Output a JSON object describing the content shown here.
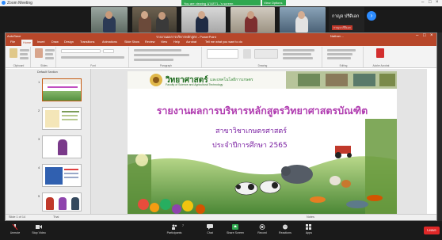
{
  "window": {
    "title": "Zoom Meeting"
  },
  "share": {
    "banner": "You are viewing นางสาว...'s screen",
    "view_options": "View Options"
  },
  "gallery": {
    "participants": [
      {
        "name": ""
      },
      {
        "name": ""
      },
      {
        "name": ""
      },
      {
        "name": ""
      },
      {
        "name": ""
      }
    ],
    "name_tile_title": "กาญจ ปรีดิเอก",
    "name_tile_sub": "กาญจ ปรีดิเอก"
  },
  "ppt": {
    "title": "รายงานผลการบริหารหลักสูตร - PowerPoint",
    "user": "Nathan ...",
    "quick_access": "AutoSave",
    "tabs": [
      "File",
      "Home",
      "Insert",
      "Draw",
      "Design",
      "Transitions",
      "Animations",
      "Slide Show",
      "Review",
      "View",
      "Help",
      "Acrobat",
      "Tell me what you want to do"
    ],
    "active_tab": "Home",
    "ribbon_groups": [
      "Clipboard",
      "Slides",
      "Font",
      "Paragraph",
      "Drawing",
      "Editing",
      "Adobe Acrobat"
    ],
    "thumbs_header": "Default Section",
    "thumb_numbers": [
      "1",
      "2",
      "3",
      "4",
      "5"
    ],
    "status": {
      "left": "Slide 1 of 14",
      "lang": "Thai",
      "notes": "Notes",
      "zoom": ""
    }
  },
  "slide": {
    "faculty": "วิทยาศาสตร์",
    "faculty_sub": "และเทคโนโลยีการเกษตร",
    "faculty_en": "Faculty of Science and Agricultural Technology",
    "title": "รายงานผลการบริหารหลักสูตรวิทยาศาสตรบัณฑิต",
    "subtitle1": "สาขาวิชาเกษตรศาสตร์",
    "subtitle2": "ประจำปีการศึกษา 2565"
  },
  "toolbar": {
    "items": [
      "Unmute",
      "Stop Video",
      "Participants",
      "Chat",
      "Share Screen",
      "Record",
      "Reactions",
      "Apps"
    ],
    "leave": "Leave",
    "participant_count": "7"
  }
}
